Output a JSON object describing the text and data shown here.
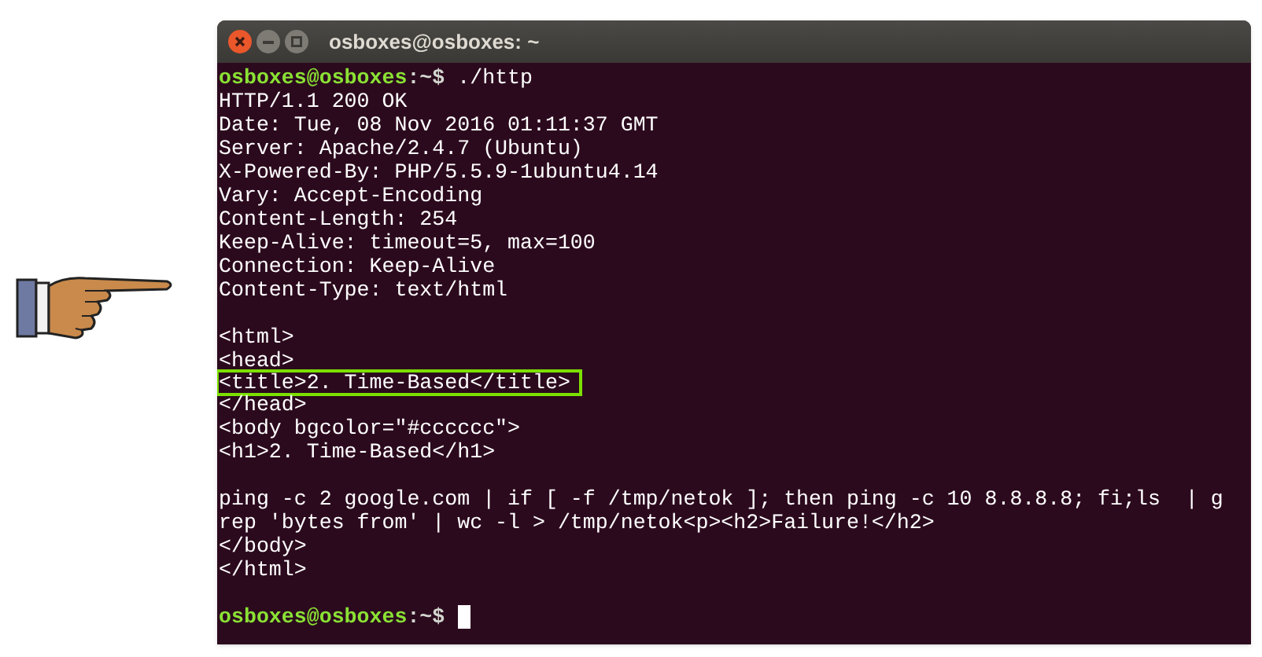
{
  "window": {
    "title": "osboxes@osboxes: ~"
  },
  "lines": [
    {
      "kind": "prompt",
      "user": "osboxes@osboxes",
      "path": ":~$",
      "command": "./http",
      "cursor": false
    },
    {
      "kind": "output",
      "text": "HTTP/1.1 200 OK",
      "highlighted": false
    },
    {
      "kind": "output",
      "text": "Date: Tue, 08 Nov 2016 01:11:37 GMT",
      "highlighted": false
    },
    {
      "kind": "output",
      "text": "Server: Apache/2.4.7 (Ubuntu)",
      "highlighted": false
    },
    {
      "kind": "output",
      "text": "X-Powered-By: PHP/5.5.9-1ubuntu4.14",
      "highlighted": false
    },
    {
      "kind": "output",
      "text": "Vary: Accept-Encoding",
      "highlighted": false
    },
    {
      "kind": "output",
      "text": "Content-Length: 254",
      "highlighted": false
    },
    {
      "kind": "output",
      "text": "Keep-Alive: timeout=5, max=100",
      "highlighted": false
    },
    {
      "kind": "output",
      "text": "Connection: Keep-Alive",
      "highlighted": false
    },
    {
      "kind": "output",
      "text": "Content-Type: text/html",
      "highlighted": false
    },
    {
      "kind": "blank"
    },
    {
      "kind": "output",
      "text": "<html>",
      "highlighted": false
    },
    {
      "kind": "output",
      "text": "<head>",
      "highlighted": false
    },
    {
      "kind": "output",
      "text": "<title>2. Time-Based</title>",
      "highlighted": true
    },
    {
      "kind": "output",
      "text": "</head>",
      "highlighted": false
    },
    {
      "kind": "output",
      "text": "<body bgcolor=\"#cccccc\">",
      "highlighted": false
    },
    {
      "kind": "output",
      "text": "<h1>2. Time-Based</h1>",
      "highlighted": false
    },
    {
      "kind": "blank"
    },
    {
      "kind": "output",
      "text": "ping -c 2 google.com | if [ -f /tmp/netok ]; then ping -c 10 8.8.8.8; fi;ls  | g",
      "highlighted": false
    },
    {
      "kind": "output",
      "text": "rep 'bytes from' | wc -l > /tmp/netok<p><h2>Failure!</h2>",
      "highlighted": false
    },
    {
      "kind": "output",
      "text": "</body>",
      "highlighted": false
    },
    {
      "kind": "output",
      "text": "</html>",
      "highlighted": false
    },
    {
      "kind": "blank"
    },
    {
      "kind": "prompt",
      "user": "osboxes@osboxes",
      "path": ":~$",
      "cursor": true
    }
  ]
}
